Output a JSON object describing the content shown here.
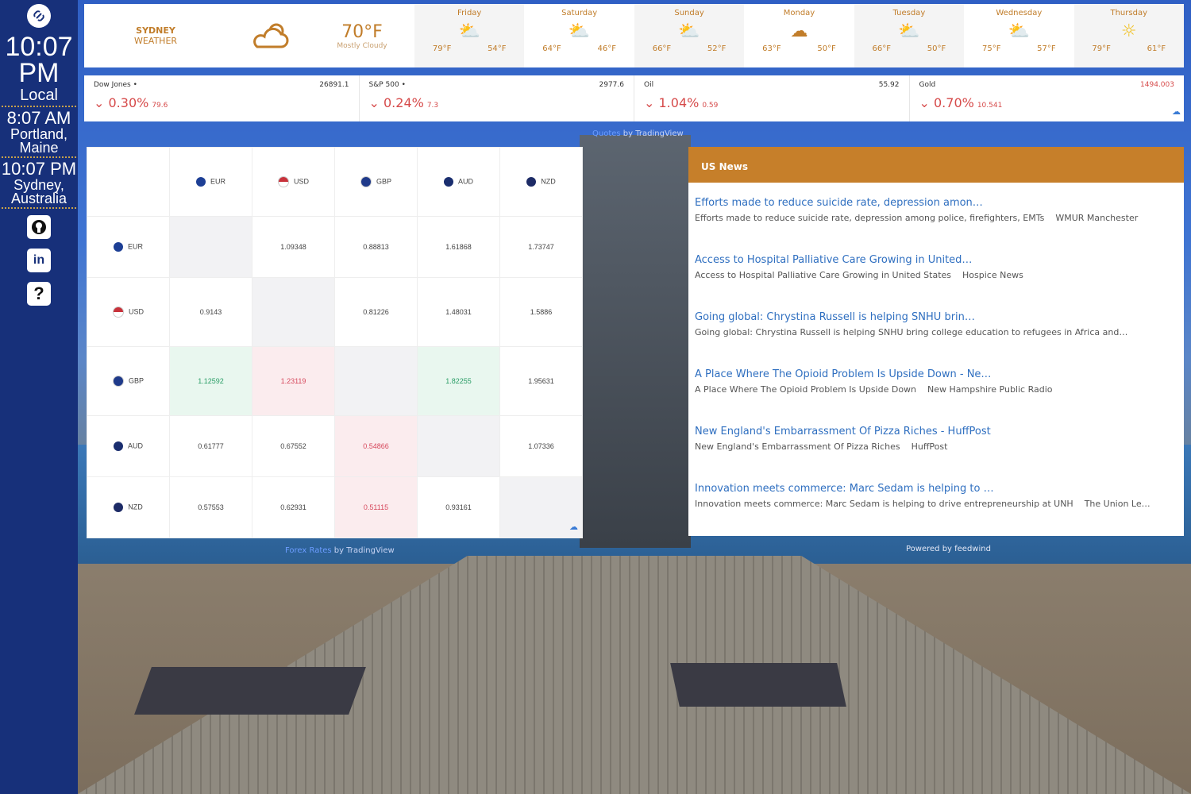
{
  "sidebar": {
    "local_time": "10:07",
    "local_ampm": "PM",
    "local_label": "Local",
    "portland_time": "8:07 AM",
    "portland_city": "Portland,",
    "portland_state": "Maine",
    "sydney_time": "10:07 PM",
    "sydney_city": "Sydney,",
    "sydney_country": "Australia",
    "icons": [
      "link-icon",
      "github-icon",
      "linkedin-icon",
      "help-icon"
    ],
    "help_glyph": "?"
  },
  "weather": {
    "city": "SYDNEY",
    "label": "WEATHER",
    "current_temp": "70",
    "unit": "°F",
    "condition": "Mostly Cloudy",
    "days": [
      {
        "name": "Friday",
        "icon": "partly-sunny-icon",
        "high": "79°F",
        "low": "54°F"
      },
      {
        "name": "Saturday",
        "icon": "partly-sunny-icon",
        "high": "64°F",
        "low": "46°F"
      },
      {
        "name": "Sunday",
        "icon": "partly-sunny-icon",
        "high": "66°F",
        "low": "52°F"
      },
      {
        "name": "Monday",
        "icon": "cloud-icon",
        "high": "63°F",
        "low": "50°F"
      },
      {
        "name": "Tuesday",
        "icon": "partly-sunny-icon",
        "high": "66°F",
        "low": "50°F"
      },
      {
        "name": "Wednesday",
        "icon": "partly-sunny-icon",
        "high": "75°F",
        "low": "57°F"
      },
      {
        "name": "Thursday",
        "icon": "sun-icon",
        "high": "79°F",
        "low": "61°F"
      }
    ]
  },
  "tickers": [
    {
      "name": "Dow Jones",
      "dot": "•",
      "price": "26891.1",
      "pct": "0.30%",
      "delta": "79.6"
    },
    {
      "name": "S&P 500",
      "dot": "•",
      "price": "2977.6",
      "pct": "0.24%",
      "delta": "7.3"
    },
    {
      "name": "Oil",
      "dot": "",
      "price": "55.92",
      "pct": "1.04%",
      "delta": "0.59"
    },
    {
      "name": "Gold",
      "dot": "",
      "price": "1494.003",
      "pct": "0.70%",
      "delta": "10.541"
    }
  ],
  "ticker_credit": {
    "link": "Quotes",
    "text": " by TradingView"
  },
  "forex": {
    "currencies": [
      "EUR",
      "USD",
      "GBP",
      "AUD",
      "NZD"
    ],
    "rows": [
      [
        "",
        "1.09348",
        "0.88813",
        "1.61868",
        "1.73747"
      ],
      [
        "0.9143",
        "",
        "0.81226",
        "1.48031",
        "1.5886"
      ],
      [
        "1.12592",
        "1.23119",
        "",
        "1.82255",
        "1.95631"
      ],
      [
        "0.61777",
        "0.67552",
        "0.54866",
        "",
        "1.07336"
      ],
      [
        "0.57553",
        "0.62931",
        "0.51115",
        "0.93161",
        ""
      ]
    ],
    "credit_link": "Forex Rates",
    "credit_text": " by TradingView"
  },
  "news": {
    "heading": "US News",
    "items": [
      {
        "title": "Efforts made to reduce suicide rate, depression amon…",
        "desc": "Efforts made to reduce suicide rate, depression among police, firefighters, EMTs",
        "source": "WMUR Manchester"
      },
      {
        "title": "Access to Hospital Palliative Care Growing in United…",
        "desc": "Access to Hospital Palliative Care Growing in United States",
        "source": "Hospice News"
      },
      {
        "title": "Going global: Chrystina Russell is helping SNHU brin…",
        "desc": "Going global: Chrystina Russell is helping SNHU bring college education to refugees in Africa and…",
        "source": ""
      },
      {
        "title": "A Place Where The Opioid Problem Is Upside Down - Ne…",
        "desc": "A Place Where The Opioid Problem Is Upside Down",
        "source": "New Hampshire Public Radio"
      },
      {
        "title": "New England's Embarrassment Of Pizza Riches - HuffPost",
        "desc": "New England's Embarrassment Of Pizza Riches",
        "source": "HuffPost"
      },
      {
        "title": "Innovation meets commerce: Marc Sedam is helping to …",
        "desc": "Innovation meets commerce: Marc Sedam is helping to drive entrepreneurship at UNH",
        "source": "The Union Le…"
      }
    ],
    "credit": "Powered by feedwind"
  }
}
